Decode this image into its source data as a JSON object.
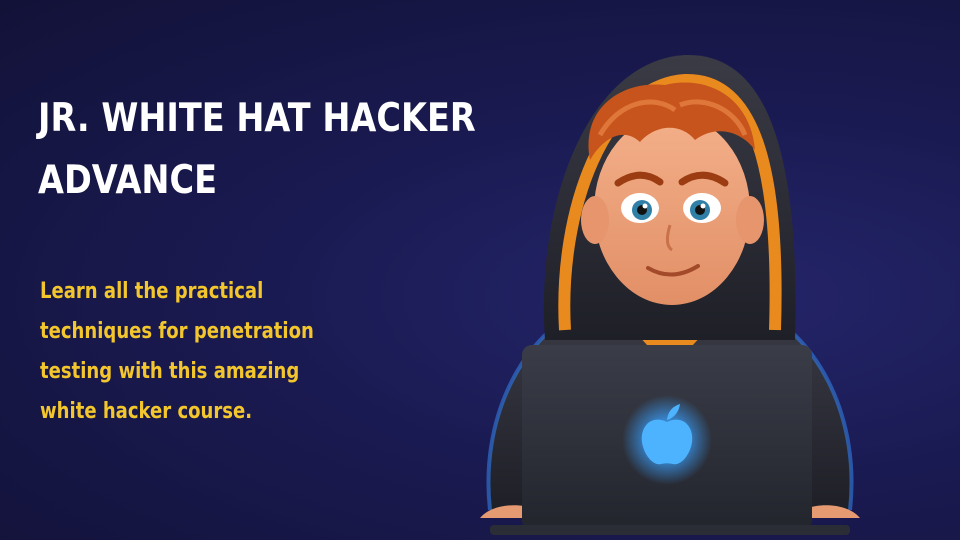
{
  "slide": {
    "title_lines": [
      "JR. WHITE HAT HACKER",
      "ADVANCE"
    ],
    "subtitle_lines": [
      "Learn all the practical",
      "techniques for penetration",
      "testing with this amazing",
      "white hacker course."
    ]
  },
  "illustration": {
    "subject": "hooded-boy-with-laptop",
    "logo_icon": "apple-icon"
  },
  "colors": {
    "background": "#1a1a52",
    "title": "#ffffff",
    "subtitle": "#f2c62c",
    "hoodie_trim": "#e98a1e",
    "laptop_glow": "#3aa0ff"
  }
}
